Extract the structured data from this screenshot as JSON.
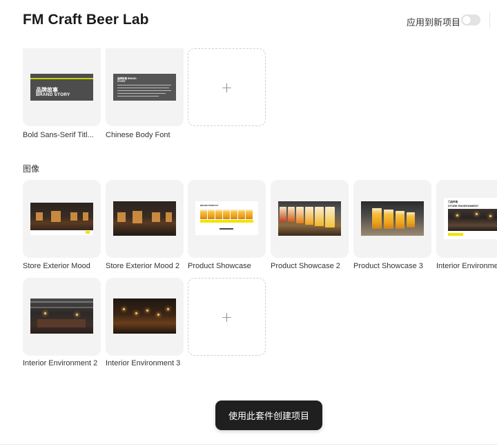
{
  "header": {
    "title": "FM Craft Beer Lab",
    "apply_label": "应用到新项目",
    "apply_enabled": false
  },
  "fonts": {
    "items": [
      {
        "caption": "Bold Sans-Serif Titl...",
        "thumb_cn": "品牌故事",
        "thumb_en": "BRAND STORY"
      },
      {
        "caption": "Chinese Body Font",
        "thumb_heading": "品牌故事 BRAND STORY"
      }
    ],
    "add_symbol": "+"
  },
  "images": {
    "section_label": "图像",
    "items": [
      {
        "caption": "Store Exterior Mood"
      },
      {
        "caption": "Store Exterior Mood 2"
      },
      {
        "caption": "Product Showcase",
        "thumb_text": "BRAND PRODUCT"
      },
      {
        "caption": "Product Showcase 2"
      },
      {
        "caption": "Product Showcase 3"
      },
      {
        "caption": "Interior Environme",
        "thumb_text_1": "门店环境",
        "thumb_text_2": "STORE ENVIRONMENT"
      },
      {
        "caption": "Interior Environment 2"
      },
      {
        "caption": "Interior Environment 3"
      }
    ],
    "add_symbol": "+"
  },
  "cta": {
    "label": "使用此套件创建项目"
  },
  "colors": {
    "accent_yellow": "#f2e300",
    "button_bg": "#1f1f1f",
    "tile_bg": "#f3f3f3"
  }
}
